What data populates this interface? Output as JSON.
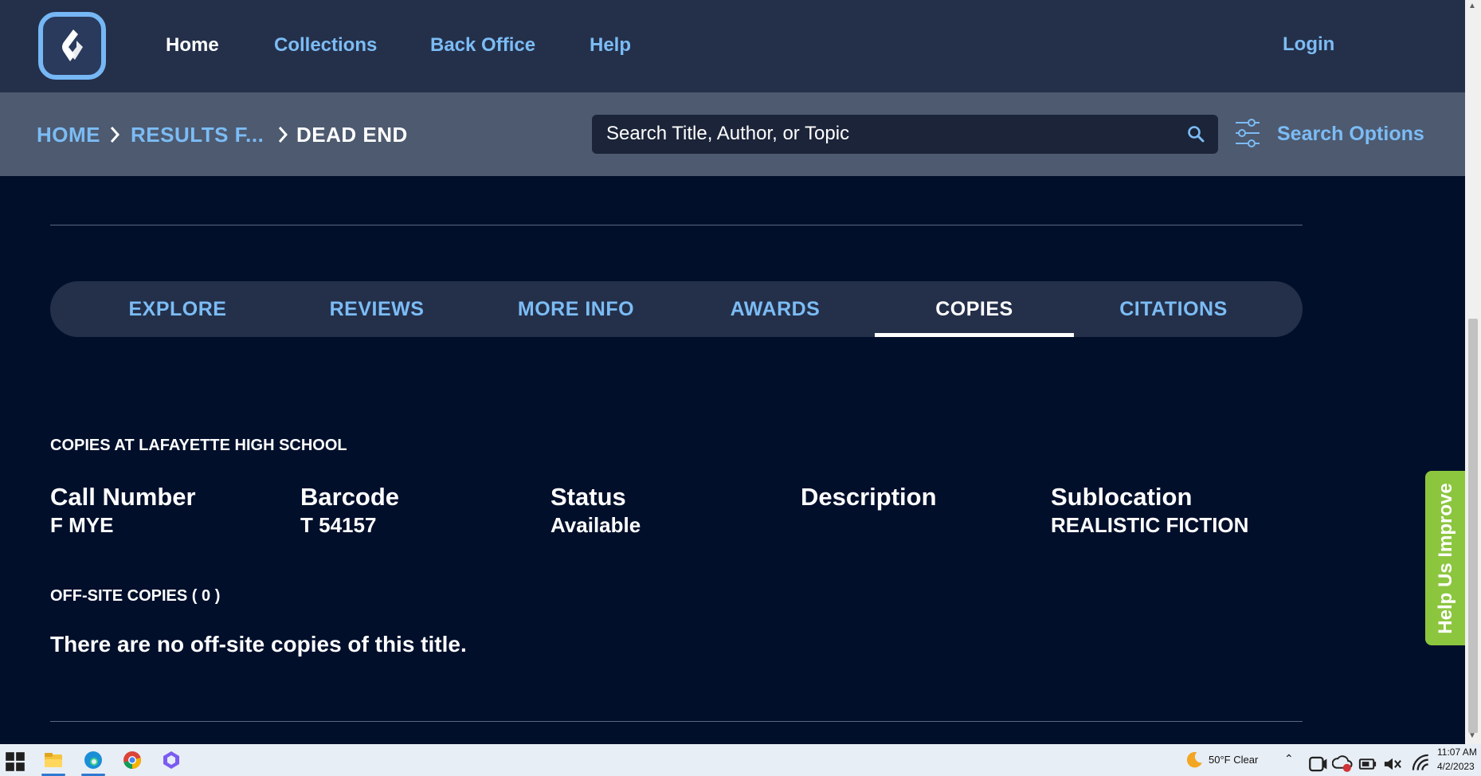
{
  "nav": {
    "links": [
      {
        "label": "Home",
        "active": true
      },
      {
        "label": "Collections",
        "active": false
      },
      {
        "label": "Back Office",
        "active": false
      },
      {
        "label": "Help",
        "active": false
      }
    ],
    "login": "Login"
  },
  "breadcrumb": {
    "home": "HOME",
    "results": "RESULTS F...",
    "current": "DEAD END"
  },
  "search": {
    "placeholder": "Search Title, Author, or Topic",
    "options_label": "Search Options"
  },
  "tabs": [
    {
      "label": "EXPLORE",
      "active": false
    },
    {
      "label": "REVIEWS",
      "active": false
    },
    {
      "label": "MORE INFO",
      "active": false
    },
    {
      "label": "AWARDS",
      "active": false
    },
    {
      "label": "COPIES",
      "active": true
    },
    {
      "label": "CITATIONS",
      "active": false
    }
  ],
  "copies": {
    "title": "COPIES AT LAFAYETTE HIGH SCHOOL",
    "columns": [
      {
        "header": "Call Number",
        "value": "F MYE"
      },
      {
        "header": "Barcode",
        "value": "T 54157"
      },
      {
        "header": "Status",
        "value": "Available"
      },
      {
        "header": "Description",
        "value": ""
      },
      {
        "header": "Sublocation",
        "value": "REALISTIC FICTION"
      }
    ],
    "offsite_title": "OFF-SITE COPIES ( 0 )",
    "offsite_message": "There are no off-site copies of this title."
  },
  "feedback": {
    "label": "Help Us Improve"
  },
  "taskbar": {
    "weather": "50°F  Clear",
    "time": "11:07 AM",
    "date": "4/2/2023"
  },
  "colors": {
    "background": "#010f2b",
    "nav_bg": "#24304a",
    "crumb_bg": "#4d5a70",
    "link": "#7cbcf5",
    "feedback": "#8cc63f"
  }
}
